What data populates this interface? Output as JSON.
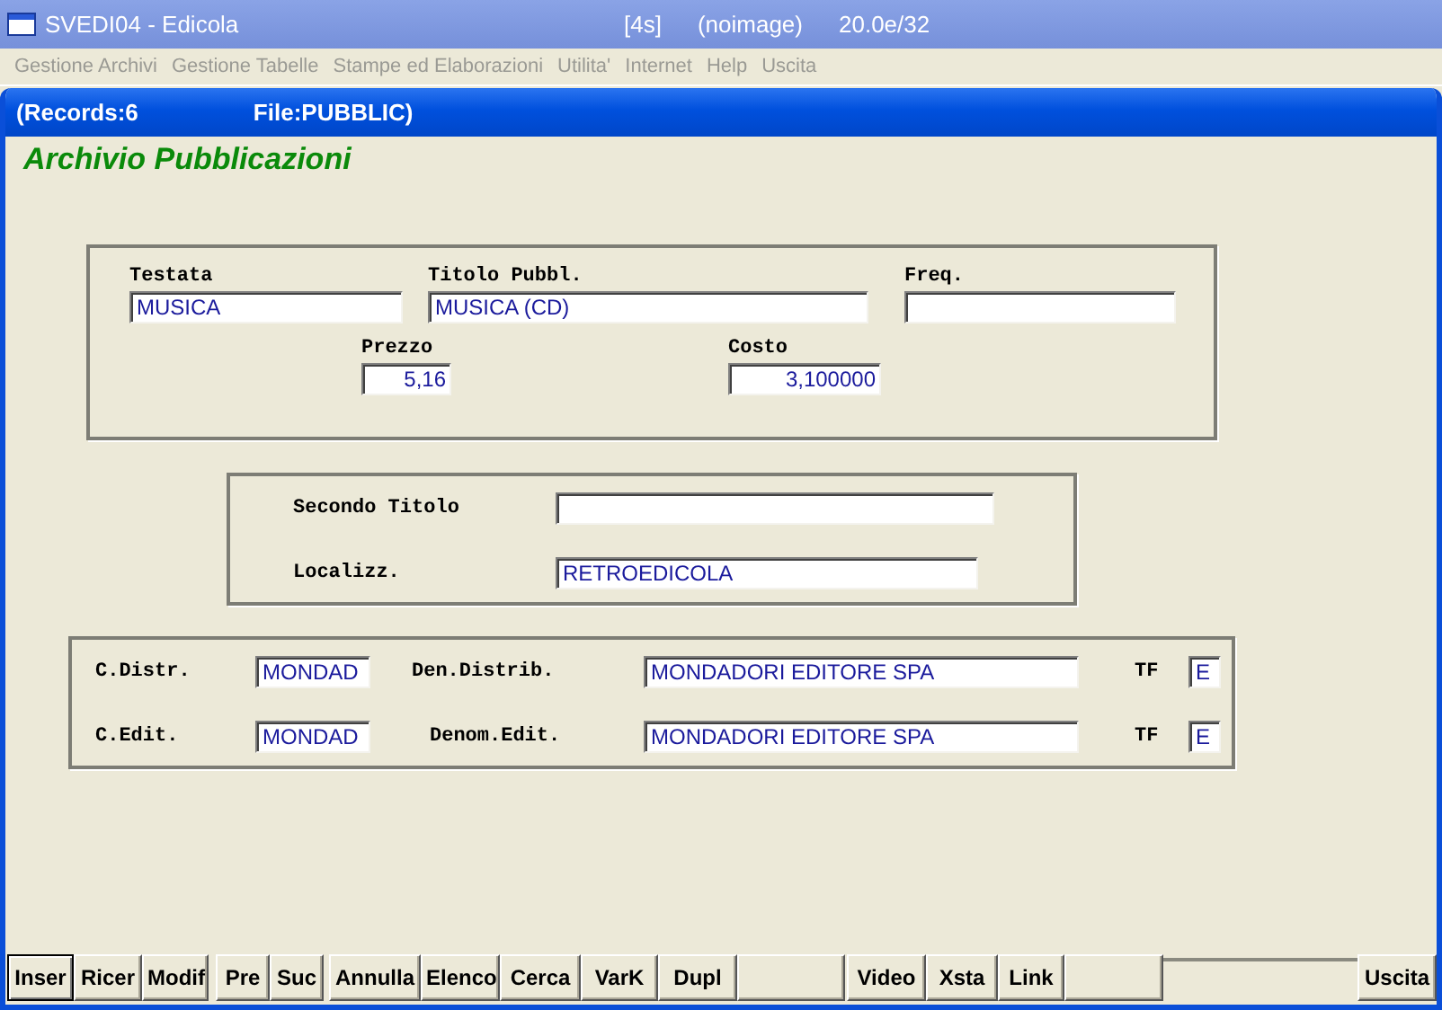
{
  "window": {
    "title": "SVEDI04 - Edicola",
    "status": [
      "[4s]",
      "(noimage)",
      "20.0e/32"
    ]
  },
  "menu": [
    {
      "label": "Gestione Archivi"
    },
    {
      "label": "Gestione Tabelle"
    },
    {
      "label": "Stampe ed Elaborazioni"
    },
    {
      "label": "Utilita'"
    },
    {
      "label": "Internet"
    },
    {
      "label": "Help"
    },
    {
      "label": "Uscita"
    }
  ],
  "document": {
    "records": "(Records:6",
    "file": "File:PUBBLIC)"
  },
  "form_title": "Archivio Pubblicazioni",
  "panels": [
    {
      "fields": [
        {
          "label": "Testata",
          "value": "MUSICA",
          "kind": "text"
        },
        {
          "label": "Titolo Pubbl.",
          "value": "MUSICA (CD)",
          "kind": "text"
        },
        {
          "label": "Freq.",
          "kind": "text"
        },
        {
          "label": "Prezzo",
          "value": "5,16",
          "kind": "number"
        },
        {
          "label": "Costo",
          "value": "3,100000",
          "kind": "number"
        }
      ]
    },
    {
      "fields": [
        {
          "label": "Secondo Titolo",
          "kind": "text"
        },
        {
          "label": "Localizz.",
          "value": "RETROEDICOLA",
          "kind": "text"
        }
      ]
    },
    {
      "fields": [
        {
          "label": "C.Distr.",
          "value": "MONDAD",
          "kind": "text"
        },
        {
          "label": "Den.Distrib.",
          "value": "MONDADORI EDITORE SPA",
          "kind": "text"
        },
        {
          "label": "TF",
          "value": "E",
          "kind": "text"
        },
        {
          "label": "C.Edit.",
          "value": "MONDAD",
          "kind": "text"
        },
        {
          "label": "Denom.Edit.",
          "value": "MONDADORI EDITORE SPA",
          "kind": "text"
        },
        {
          "label": "TF",
          "value": "E",
          "kind": "text"
        }
      ]
    }
  ],
  "buttons": [
    {
      "kind": "button",
      "label": "Inser",
      "selected": true
    },
    {
      "kind": "button",
      "label": "Ricer",
      "selected": false
    },
    {
      "kind": "button",
      "label": "Modif",
      "selected": false
    },
    {
      "kind": "button",
      "label": "Pre",
      "selected": false
    },
    {
      "kind": "button",
      "label": "Suc",
      "selected": false
    },
    {
      "kind": "button",
      "label": "Annulla",
      "selected": false
    },
    {
      "kind": "button",
      "label": "Elenco",
      "selected": false
    },
    {
      "kind": "button",
      "label": "Cerca",
      "selected": false
    },
    {
      "kind": "button",
      "label": "VarK",
      "selected": false
    },
    {
      "kind": "button",
      "label": "Dupl",
      "selected": false
    },
    {
      "kind": "blank",
      "selected": false
    },
    {
      "kind": "button",
      "label": "Video",
      "selected": false
    },
    {
      "kind": "button",
      "label": "Xsta",
      "selected": false
    },
    {
      "kind": "button",
      "label": "Link",
      "selected": false
    },
    {
      "kind": "blank",
      "selected": false
    },
    {
      "kind": "button",
      "label": "Uscita",
      "selected": false
    }
  ]
}
